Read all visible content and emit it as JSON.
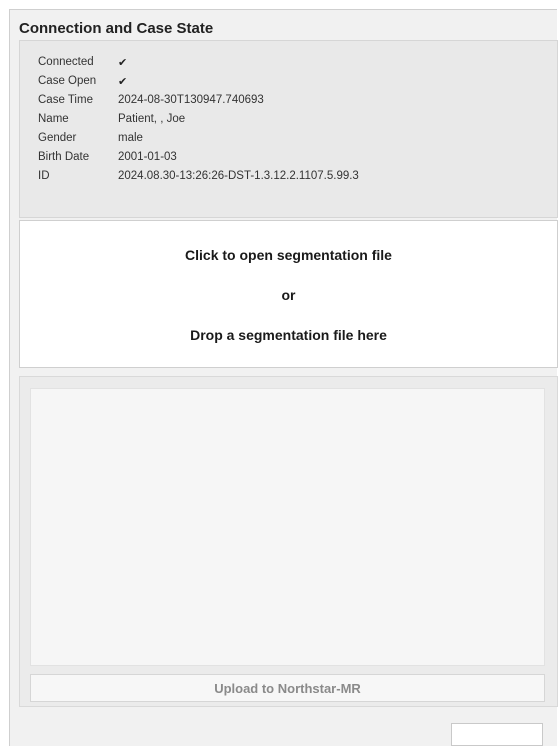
{
  "connection_panel": {
    "title": "Connection and Case State",
    "rows": [
      {
        "label": "Connected",
        "value": "✔"
      },
      {
        "label": "Case Open",
        "value": "✔"
      },
      {
        "label": "Case Time",
        "value": "2024-08-30T130947.740693"
      },
      {
        "label": "Name",
        "value": "Patient, , Joe"
      },
      {
        "label": "Gender",
        "value": "male"
      },
      {
        "label": "Birth Date",
        "value": "2001-01-03"
      },
      {
        "label": "ID",
        "value": "2024.08.30-13:26:26-DST-1.3.12.2.1107.5.99.3"
      }
    ]
  },
  "drop_zone": {
    "line1": "Click to open segmentation file",
    "line2": "or",
    "line3": "Drop a segmentation file here"
  },
  "upload": {
    "button_label": "Upload to Northstar-MR"
  },
  "footer_field": {
    "value": ""
  }
}
